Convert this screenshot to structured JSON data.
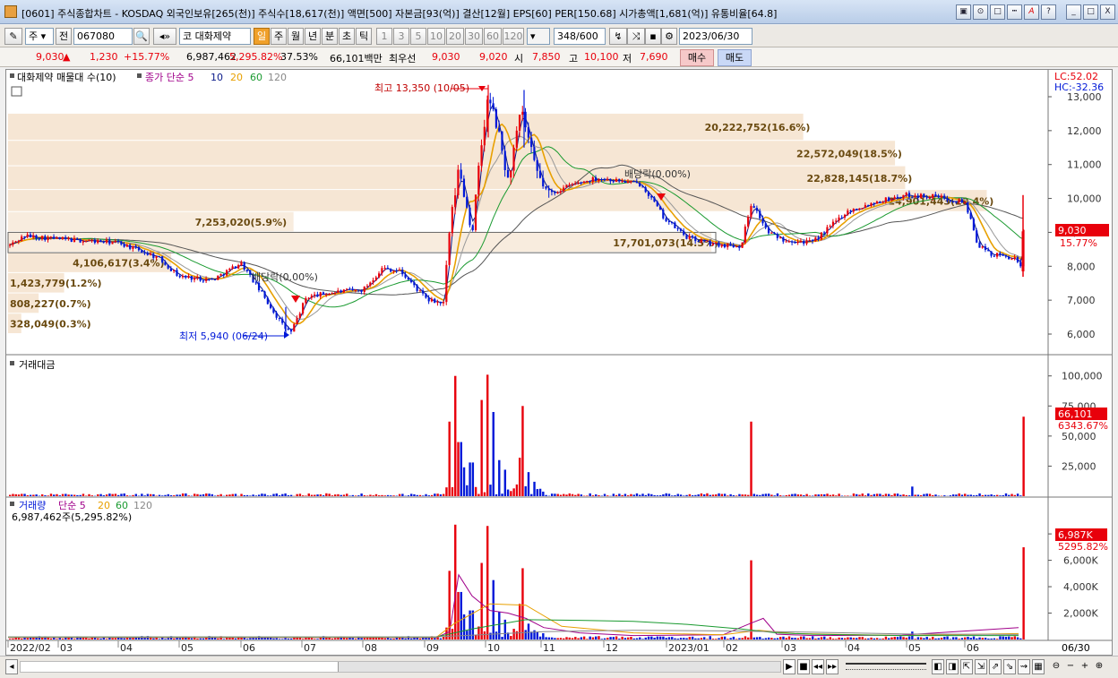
{
  "window": {
    "title": "[0601] 주식종합차트 - KOSDAQ 외국인보유[265(천)] 주식수[18,617(천)] 액면[500] 자본금[93(억)] 결산[12월] EPS[60] PER[150.68] 시가총액[1,681(억)] 유통비율[64.8]",
    "buttons": [
      "▣",
      "⊙",
      "□",
      "┅",
      "A",
      "?",
      "_",
      "□",
      "X"
    ]
  },
  "toolbar": {
    "period_select": "주",
    "jeon_label": "전",
    "code": "067080",
    "market_tag": "코",
    "stock_name": "대화제약",
    "periods": [
      "일",
      "주",
      "월",
      "년",
      "분",
      "초",
      "틱"
    ],
    "active_period": "일",
    "intervals": [
      "1",
      "3",
      "5",
      "10",
      "20",
      "30",
      "60",
      "120"
    ],
    "count_value": "348",
    "count_total": "/600",
    "date_value": "2023/06/30"
  },
  "quote": {
    "price": "9,030",
    "change": "1,230",
    "pct": "+15.77%",
    "volume": "6,987,462",
    "volume_pct": "5,295.82%",
    "turnover": "37.53%",
    "amount": "66,101백만",
    "best_label": "최우선",
    "ask": "9,030",
    "bid": "9,020",
    "open_label": "시",
    "open": "7,850",
    "high_label": "고",
    "high": "10,100",
    "low_label": "저",
    "low": "7,690",
    "buy_label": "매수",
    "sell_label": "매도"
  },
  "colors": {
    "up": "#e8000b",
    "down": "#0018d8",
    "ma5": "#0a1a8a",
    "ma10": "#e8a000",
    "ma20": "#1a9a30",
    "ma60": "#555555",
    "band": "#f5e2cc"
  },
  "price_panel": {
    "legend_title": "대화제약 매물대 수(10)",
    "ma_legend": [
      "종가 단순 5",
      "10",
      "20",
      "60",
      "120"
    ],
    "lc_label": "LC:52.02",
    "hc_label": "HC:-32.36",
    "high_note": "최고 13,350 (10/05)",
    "low_note": "최저 5,940 (06/24)",
    "dividend_notes": [
      "배당락(0.00%)",
      "배당락(0.00%)"
    ],
    "current_price": "9,030",
    "current_pct": "15.77%",
    "y_ticks": [
      "13,000",
      "12,000",
      "11,000",
      "10,000",
      "9,000",
      "8,000",
      "7,000",
      "6,000"
    ],
    "volume_profile": [
      {
        "label": "20,222,752(16.6%)",
        "low": 11700,
        "high": 12500
      },
      {
        "label": "22,572,049(18.5%)",
        "low": 10950,
        "high": 11700
      },
      {
        "label": "22,828,145(18.7%)",
        "low": 10250,
        "high": 10950
      },
      {
        "label": "24,901,443(20.4%)",
        "low": 9600,
        "high": 10250
      },
      {
        "label": "7,253,020(5.9%)",
        "low": 9000,
        "high": 9600
      },
      {
        "label": "17,701,073(14.5%)",
        "low": 8400,
        "high": 9000
      },
      {
        "label": "4,106,617(3.4%)",
        "low": 7800,
        "high": 8400
      },
      {
        "label": "1,423,779(1.2%)",
        "low": 7200,
        "high": 7800
      },
      {
        "label": "808,227(0.7%)",
        "low": 6600,
        "high": 7200
      },
      {
        "label": "328,049(0.3%)",
        "low": 6000,
        "high": 6600
      }
    ]
  },
  "amount_panel": {
    "title": "거래대금",
    "y_ticks": [
      "100,000",
      "75,000",
      "50,000",
      "25,000"
    ],
    "current_value": "66,101",
    "current_pct": "6343.67%"
  },
  "volume_panel": {
    "title": "거래량",
    "ma_legend": [
      "단순 5",
      "20",
      "60",
      "120"
    ],
    "current_label": "6,987,462주(5,295.82%)",
    "y_ticks": [
      "8,000K",
      "6,000K",
      "4,000K",
      "2,000K"
    ],
    "current_value": "6,987K",
    "current_pct": "5295.82%"
  },
  "x_axis": {
    "labels": [
      "2022/02",
      "03",
      "04",
      "05",
      "06",
      "07",
      "08",
      "09",
      "10",
      "11",
      "12",
      "2023/01",
      "02",
      "03",
      "04",
      "05",
      "06"
    ],
    "end_label": "06/30"
  },
  "chart_data": {
    "type": "candlestick",
    "key_points": [
      {
        "x": "2022/02",
        "y": 8550
      },
      {
        "x": "2022/03",
        "y": 8800
      },
      {
        "x": "2022/04",
        "y": 8700
      },
      {
        "x": "2022/05",
        "y": 7700
      },
      {
        "x": "2022/06",
        "y": 7600
      },
      {
        "x": "2022/06/24",
        "y": 5940
      },
      {
        "x": "2022/07",
        "y": 7250
      },
      {
        "x": "2022/08",
        "y": 7900
      },
      {
        "x": "2022/09",
        "y": 6900
      },
      {
        "x": "2022/09",
        "y": 10900
      },
      {
        "x": "2022/10/05",
        "y": 13350
      },
      {
        "x": "2022/11",
        "y": 10100
      },
      {
        "x": "2022/12",
        "y": 10500
      },
      {
        "x": "2023/01",
        "y": 9000
      },
      {
        "x": "2023/02",
        "y": 8600
      },
      {
        "x": "2023/03",
        "y": 8800
      },
      {
        "x": "2023/04",
        "y": 9600
      },
      {
        "x": "2023/05",
        "y": 10100
      },
      {
        "x": "2023/06",
        "y": 8200
      },
      {
        "x": "2023/06/30",
        "y": 9030
      }
    ],
    "spikes_amount": [
      {
        "x": "2022/09",
        "value": 100000
      },
      {
        "x": "2022/10",
        "value": 101000
      },
      {
        "x": "2022/10",
        "value": 75000
      },
      {
        "x": "2023/02",
        "value": 62000
      },
      {
        "x": "2023/06/30",
        "value": 66101
      }
    ],
    "spikes_volume": [
      {
        "x": "2022/09",
        "value": 8700
      },
      {
        "x": "2022/10",
        "value": 8600
      },
      {
        "x": "2023/02",
        "value": 6000
      },
      {
        "x": "2023/06/30",
        "value": 6987
      }
    ]
  }
}
